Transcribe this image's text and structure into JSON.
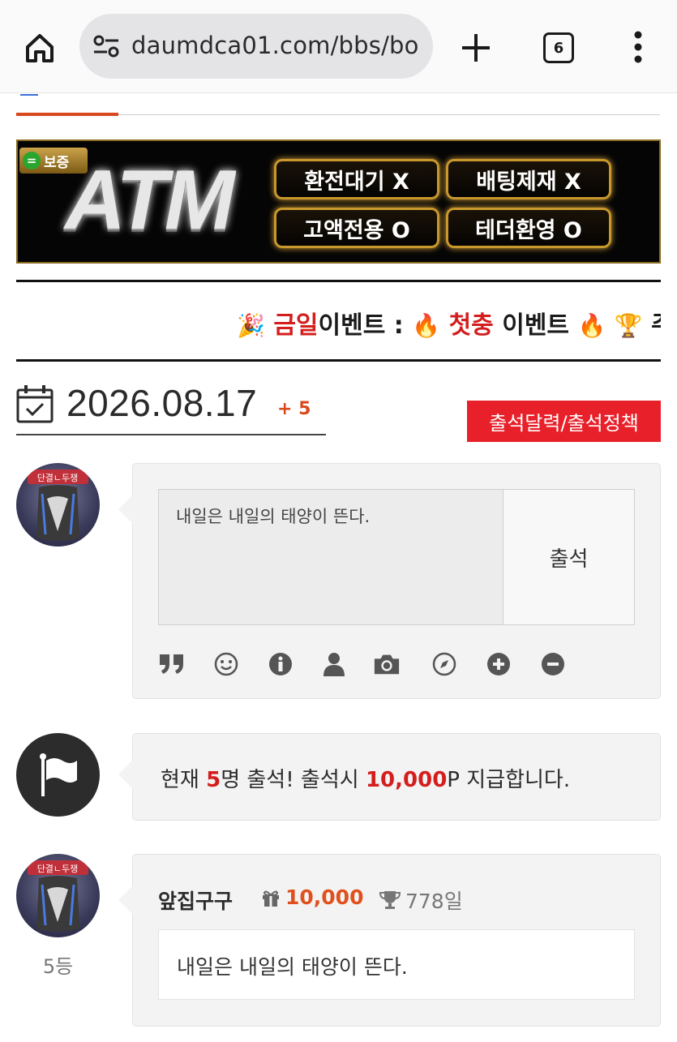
{
  "browser": {
    "url": "daumdca01.com/bbs/bo",
    "tab_count": "6"
  },
  "banner": {
    "badge_icon": "=",
    "badge_text": "보증",
    "logo": "ATM",
    "pills": [
      "환전대기 X",
      "배팅제재 X",
      "고액전용 O",
      "테더환영 O"
    ]
  },
  "marquee": {
    "emoji_party": "🎉",
    "today": "금일",
    "event_label": "이벤트 :",
    "fire": "🔥",
    "first_deposit": "첫충",
    "event_word": "이벤트",
    "trophy": "🏆",
    "tail": "주"
  },
  "attendance": {
    "date": "2026.08.17",
    "plus": "+ 5",
    "policy_button": "출석달력/출석정책",
    "input_value": "내일은 내일의 태양이 뜬다.",
    "submit_label": "출석",
    "toolbar_icons": [
      "quote-icon",
      "smile-icon",
      "info-icon",
      "user-icon",
      "camera-icon",
      "compass-icon",
      "plus-circle-icon",
      "minus-circle-icon"
    ]
  },
  "status": {
    "prefix": "현재 ",
    "count": "5",
    "middle": "명 출석! 출석시 ",
    "points": "10,000",
    "suffix": "P 지급합니다."
  },
  "entry": {
    "name": "앞집구구",
    "points": "10,000",
    "days": "778일",
    "message": "내일은 내일의 태양이 뜬다.",
    "rank": "5등",
    "avatar_caption": "단결ㄴ두쟁"
  },
  "colors": {
    "accent": "#d8481c",
    "red": "#d41e1e",
    "policy_bg": "#e8202a",
    "card_bg": "#f3f3f3"
  }
}
